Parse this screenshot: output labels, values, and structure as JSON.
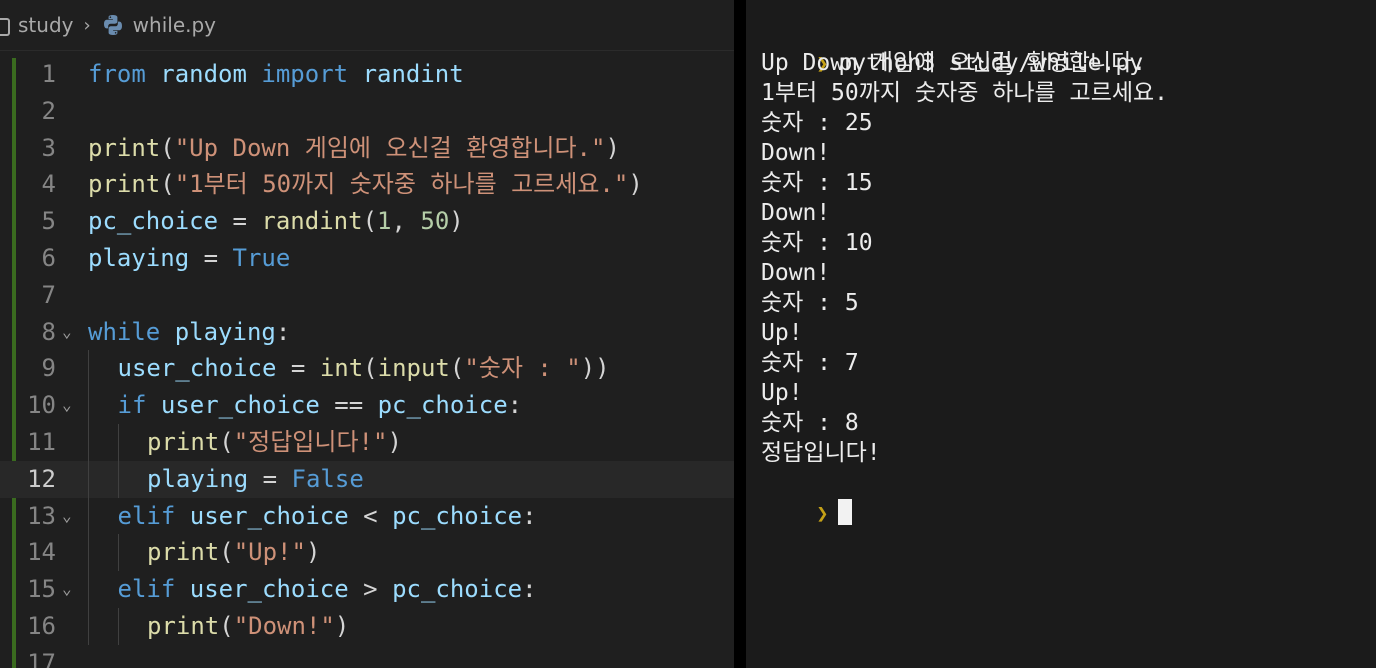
{
  "breadcrumb": {
    "folder": "study",
    "separator": "›",
    "file": "while.py"
  },
  "editor": {
    "current_line": 12,
    "lines": [
      {
        "n": "1",
        "fold": false,
        "indent": 0,
        "tokens": [
          [
            "kw",
            "from"
          ],
          [
            "op",
            " "
          ],
          [
            "id",
            "random"
          ],
          [
            "op",
            " "
          ],
          [
            "kw",
            "import"
          ],
          [
            "op",
            " "
          ],
          [
            "id",
            "randint"
          ]
        ]
      },
      {
        "n": "2",
        "fold": false,
        "indent": 0,
        "tokens": []
      },
      {
        "n": "3",
        "fold": false,
        "indent": 0,
        "tokens": [
          [
            "fn",
            "print"
          ],
          [
            "op",
            "("
          ],
          [
            "str",
            "\"Up Down 게임에 오신걸 환영합니다.\""
          ],
          [
            "op",
            ")"
          ]
        ]
      },
      {
        "n": "4",
        "fold": false,
        "indent": 0,
        "tokens": [
          [
            "fn",
            "print"
          ],
          [
            "op",
            "("
          ],
          [
            "str",
            "\"1부터 50까지 숫자중 하나를 고르세요.\""
          ],
          [
            "op",
            ")"
          ]
        ]
      },
      {
        "n": "5",
        "fold": false,
        "indent": 0,
        "tokens": [
          [
            "id",
            "pc_choice"
          ],
          [
            "op",
            " = "
          ],
          [
            "fn",
            "randint"
          ],
          [
            "op",
            "("
          ],
          [
            "num",
            "1"
          ],
          [
            "op",
            ", "
          ],
          [
            "num",
            "50"
          ],
          [
            "op",
            ")"
          ]
        ]
      },
      {
        "n": "6",
        "fold": false,
        "indent": 0,
        "tokens": [
          [
            "id",
            "playing"
          ],
          [
            "op",
            " = "
          ],
          [
            "kw",
            "True"
          ]
        ]
      },
      {
        "n": "7",
        "fold": false,
        "indent": 0,
        "tokens": []
      },
      {
        "n": "8",
        "fold": true,
        "indent": 0,
        "tokens": [
          [
            "kw",
            "while"
          ],
          [
            "op",
            " "
          ],
          [
            "id",
            "playing"
          ],
          [
            "op",
            ":"
          ]
        ]
      },
      {
        "n": "9",
        "fold": false,
        "indent": 1,
        "tokens": [
          [
            "id",
            "user_choice"
          ],
          [
            "op",
            " = "
          ],
          [
            "fn",
            "int"
          ],
          [
            "op",
            "("
          ],
          [
            "fn",
            "input"
          ],
          [
            "op",
            "("
          ],
          [
            "str",
            "\"숫자 : \""
          ],
          [
            "op",
            "))"
          ]
        ]
      },
      {
        "n": "10",
        "fold": true,
        "indent": 1,
        "tokens": [
          [
            "kw",
            "if"
          ],
          [
            "op",
            " "
          ],
          [
            "id",
            "user_choice"
          ],
          [
            "op",
            " == "
          ],
          [
            "id",
            "pc_choice"
          ],
          [
            "op",
            ":"
          ]
        ]
      },
      {
        "n": "11",
        "fold": false,
        "indent": 2,
        "tokens": [
          [
            "fn",
            "print"
          ],
          [
            "op",
            "("
          ],
          [
            "str",
            "\"정답입니다!\""
          ],
          [
            "op",
            ")"
          ]
        ]
      },
      {
        "n": "12",
        "fold": false,
        "indent": 2,
        "tokens": [
          [
            "id",
            "playing"
          ],
          [
            "op",
            " = "
          ],
          [
            "kw",
            "False"
          ]
        ]
      },
      {
        "n": "13",
        "fold": true,
        "indent": 1,
        "tokens": [
          [
            "kw",
            "elif"
          ],
          [
            "op",
            " "
          ],
          [
            "id",
            "user_choice"
          ],
          [
            "op",
            " < "
          ],
          [
            "id",
            "pc_choice"
          ],
          [
            "op",
            ":"
          ]
        ]
      },
      {
        "n": "14",
        "fold": false,
        "indent": 2,
        "tokens": [
          [
            "fn",
            "print"
          ],
          [
            "op",
            "("
          ],
          [
            "str",
            "\"Up!\""
          ],
          [
            "op",
            ")"
          ]
        ]
      },
      {
        "n": "15",
        "fold": true,
        "indent": 1,
        "tokens": [
          [
            "kw",
            "elif"
          ],
          [
            "op",
            " "
          ],
          [
            "id",
            "user_choice"
          ],
          [
            "op",
            " > "
          ],
          [
            "id",
            "pc_choice"
          ],
          [
            "op",
            ":"
          ]
        ]
      },
      {
        "n": "16",
        "fold": false,
        "indent": 2,
        "tokens": [
          [
            "fn",
            "print"
          ],
          [
            "op",
            "("
          ],
          [
            "str",
            "\"Down!\""
          ],
          [
            "op",
            ")"
          ]
        ]
      },
      {
        "n": "17",
        "fold": false,
        "indent": 0,
        "tokens": []
      }
    ]
  },
  "terminal": {
    "command": "python3 study/while.py",
    "output": [
      "Up Down 게임에 오신걸 환영합니다.",
      "1부터 50까지 숫자중 하나를 고르세요.",
      "숫자 : 25",
      "Down!",
      "숫자 : 15",
      "Down!",
      "숫자 : 10",
      "Down!",
      "숫자 : 5",
      "Up!",
      "숫자 : 7",
      "Up!",
      "숫자 : 8",
      "정답입니다!"
    ],
    "prompt_marker": "❯"
  },
  "colors": {
    "keyword": "#569cd6",
    "identifier": "#9cdcfe",
    "function": "#dcdcaa",
    "string": "#ce9178",
    "number": "#b5cea8",
    "prompt": "#c5a117"
  },
  "icons": {
    "folder": "folder-icon",
    "python_file": "python-icon",
    "fold": "chevron-down-icon"
  }
}
